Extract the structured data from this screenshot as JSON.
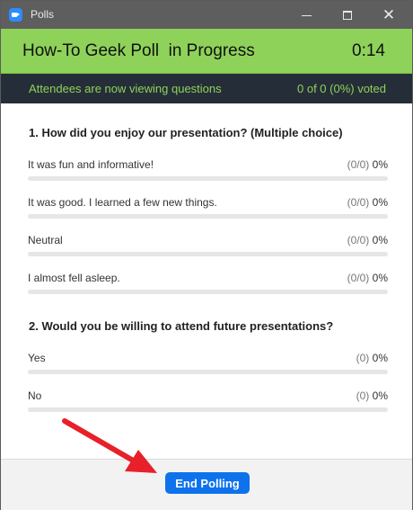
{
  "window": {
    "title": "Polls",
    "buttons": {
      "minimize_icon": "minimize-icon",
      "maximize_icon": "maximize-icon",
      "close_glyph": "✕"
    }
  },
  "header": {
    "title": "How-To Geek Poll  in Progress",
    "timer": "0:14",
    "background_color": "#8ed25a"
  },
  "status": {
    "message": "Attendees are now viewing questions",
    "votes": "0 of 0 (0%) voted",
    "text_color": "#8ed25a"
  },
  "questions": [
    {
      "title": "1. How did you enjoy our presentation? (Multiple choice)",
      "answers": [
        {
          "label": "It was fun and informative!",
          "count": "(0/0)",
          "percent": "0%",
          "fraction": 0
        },
        {
          "label": "It was good. I learned a few new things.",
          "count": "(0/0)",
          "percent": "0%",
          "fraction": 0
        },
        {
          "label": "Neutral",
          "count": "(0/0)",
          "percent": "0%",
          "fraction": 0
        },
        {
          "label": "I almost fell asleep.",
          "count": "(0/0)",
          "percent": "0%",
          "fraction": 0
        }
      ]
    },
    {
      "title": "2. Would you be willing to attend future presentations?",
      "answers": [
        {
          "label": "Yes",
          "count": "(0)",
          "percent": "0%",
          "fraction": 0
        },
        {
          "label": "No",
          "count": "(0)",
          "percent": "0%",
          "fraction": 0
        }
      ]
    }
  ],
  "footer": {
    "end_button_label": "End Polling",
    "button_color": "#0e72ed"
  },
  "annotation": {
    "icon": "red-arrow-icon",
    "color": "#e8202a"
  }
}
